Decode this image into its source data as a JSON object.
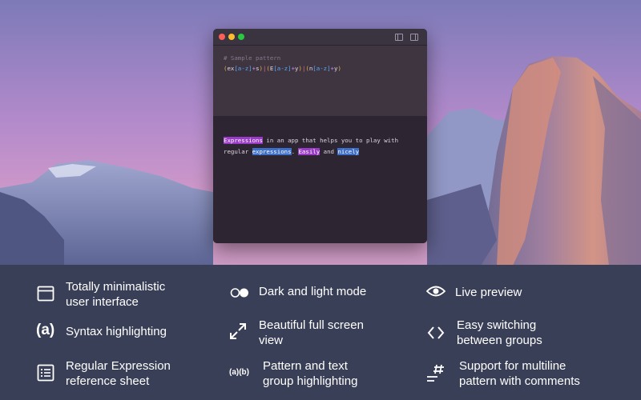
{
  "window": {
    "pattern_comment": "# Sample pattern",
    "pattern_tokens": [
      {
        "t": "(",
        "c": "c-paren"
      },
      {
        "t": "ex",
        "c": "c-lit"
      },
      {
        "t": "[a-z]",
        "c": "c-cls"
      },
      {
        "t": "+",
        "c": "c-op"
      },
      {
        "t": "s",
        "c": "c-lit"
      },
      {
        "t": ")",
        "c": "c-paren"
      },
      {
        "t": "|",
        "c": "c-alt"
      },
      {
        "t": "(",
        "c": "c-paren"
      },
      {
        "t": "E",
        "c": "c-lit"
      },
      {
        "t": "[a-z]",
        "c": "c-cls"
      },
      {
        "t": "+",
        "c": "c-op"
      },
      {
        "t": "y",
        "c": "c-lit"
      },
      {
        "t": ")",
        "c": "c-paren"
      },
      {
        "t": "|",
        "c": "c-alt"
      },
      {
        "t": "(",
        "c": "c-paren"
      },
      {
        "t": "n",
        "c": "c-lit"
      },
      {
        "t": "[a-z]",
        "c": "c-cls"
      },
      {
        "t": "+",
        "c": "c-op"
      },
      {
        "t": "y",
        "c": "c-lit"
      },
      {
        "t": ")",
        "c": "c-paren"
      }
    ],
    "text_line1": [
      {
        "t": "Expressions",
        "hl": "hl-p"
      },
      {
        "t": " in an app that helps you to play with",
        "hl": ""
      }
    ],
    "text_line2": [
      {
        "t": "regular ",
        "hl": ""
      },
      {
        "t": "expressions",
        "hl": "hl-b"
      },
      {
        "t": ". ",
        "hl": ""
      },
      {
        "t": "Easily",
        "hl": "hl-p"
      },
      {
        "t": " and ",
        "hl": ""
      },
      {
        "t": "nicely",
        "hl": "hl-b"
      }
    ]
  },
  "features": {
    "f1": {
      "icon": "window-icon",
      "line1": "Totally minimalistic",
      "line2": "user interface"
    },
    "f2": {
      "icon": "toggle-icon",
      "line1": "Dark and light mode",
      "line2": ""
    },
    "f3": {
      "icon": "eye-icon",
      "line1": "Live preview",
      "line2": ""
    },
    "f4": {
      "icon": "syntax-icon",
      "glyph": "(a)",
      "line1": "Syntax highlighting",
      "line2": ""
    },
    "f5": {
      "icon": "fullscreen-icon",
      "line1": "Beautiful full screen",
      "line2": "view"
    },
    "f6": {
      "icon": "code-brackets-icon",
      "line1": "Easy switching",
      "line2": "between groups"
    },
    "f7": {
      "icon": "list-icon",
      "line1": "Regular Expression",
      "line2": "reference sheet"
    },
    "f8": {
      "icon": "group-icon",
      "glyph": "(a)(b)",
      "line1": "Pattern and text",
      "line2": "group highlighting"
    },
    "f9": {
      "icon": "hash-lines-icon",
      "line1": "Support for multiline",
      "line2": "pattern with comments"
    }
  }
}
